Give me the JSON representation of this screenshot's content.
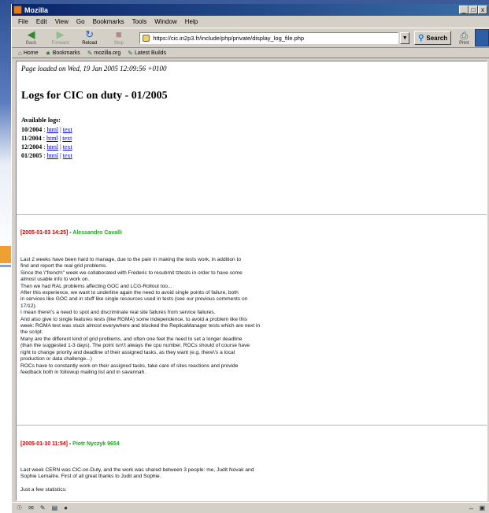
{
  "window": {
    "title": "Mozilla",
    "controls": [
      "_",
      "□",
      "x"
    ]
  },
  "menu": [
    "File",
    "Edit",
    "View",
    "Go",
    "Bookmarks",
    "Tools",
    "Window",
    "Help"
  ],
  "nav": {
    "back": "Back",
    "forward": "Forward",
    "reload": "Reload",
    "stop": "Stop",
    "url": "https://cic.in2p3.fr/include/php/private/display_log_file.php",
    "search": "Search",
    "print": "Print"
  },
  "bookmarks": [
    "Home",
    "Bookmarks",
    "mozilla.org",
    "Latest Builds"
  ],
  "page": {
    "loaded": "Page loaded on Wed, 19 Jan 2005 12:09:56 +0100",
    "heading": "Logs for CIC on duty - 01/2005",
    "available_label": "Available logs:",
    "logs": [
      {
        "month": "10/2004",
        "html": "html",
        "text": "text"
      },
      {
        "month": "11/2004",
        "html": "html",
        "text": "text"
      },
      {
        "month": "12/2004",
        "html": "html",
        "text": "text"
      },
      {
        "month": "01/2005",
        "html": "html",
        "text": "text"
      }
    ],
    "entries": [
      {
        "date": "[2005-01-03 14:25]",
        "sep": " - ",
        "author": "Alessandro Cavalli",
        "paragraph": [
          "Last 2 weeks have been hard to manage, due to the pain in making the tests work, in addition to",
          "find and report the real grid problems.",
          "Since the \\\"french\\\" week we collaborated with Frederic to resubmit tztests in order to have some",
          "almost usable info to work on.",
          "Then we had RAL problems affecting GOC and LCG-Rollout too...",
          "After this experience, we want to underline again the need to avoid single points of failure, both",
          "in services like GOC and in stuff like single resources used in tests (see our previous comments on",
          "17/12).",
          "I mean there\\'s a need to spot and discriminate real site failures from service failures.",
          "And also give to single features tests (like RGMA) some independence, to avoid a problem like this",
          "week: RGMA test was stuck almost everywhere and blocked the ReplicaManager tests which are next in",
          "the script.",
          "Many are the different kind of grid problems, and often one feel the need to set a longer deadline",
          "(than the suggested 1-3 days). The point isn\\'t always the cpu number. ROCs should of course have",
          "right to change priority and deadline of their assigned tasks, as they want (e.g. there\\'s a local",
          "production or data challenge...)",
          "ROCs have to constantly work on their assigned tasks, take care of sites reactions and provide",
          "feedback both in followup mailing list and in savannah."
        ]
      },
      {
        "date": "[2005-01-10 11:54]",
        "sep": " - ",
        "author": "Piotr Nyczyk 9654",
        "paragraph": [
          "Last week CERN was CIC-on-Duty, and the work was shared between 3 people: me, Judit Novak and",
          "Sophie Lemaitre. First of all great thanks to Judit and Sophie.",
          "",
          "Just a few statistics:"
        ]
      }
    ]
  },
  "status_icons": [
    "network-icon",
    "mail-icon",
    "composer-icon",
    "addressbook-icon",
    "irc-icon"
  ],
  "colors": {
    "titlebar": "#0a246a",
    "entry_date": "#cc0000",
    "entry_author": "#22a022",
    "link": "#0000cc"
  }
}
